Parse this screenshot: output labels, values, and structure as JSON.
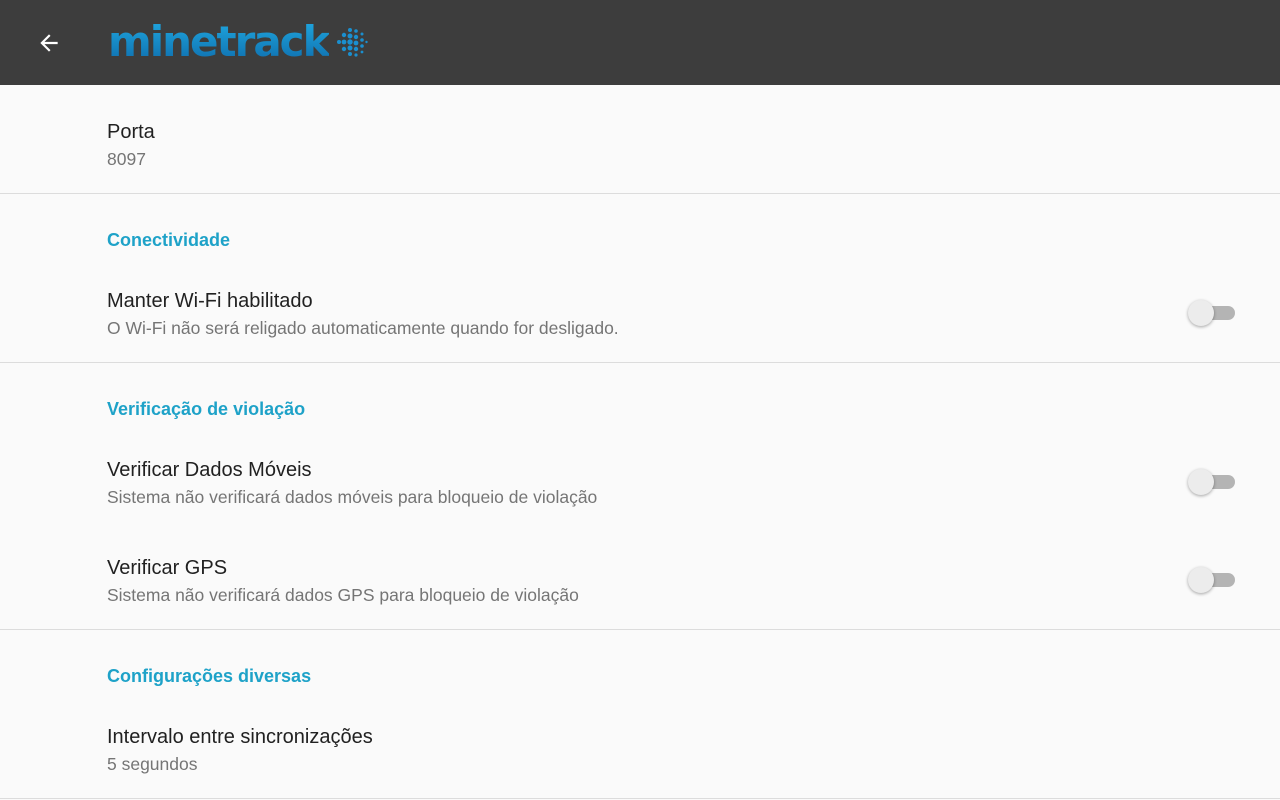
{
  "appbar": {
    "back_icon": "arrow-back-icon",
    "logo_text": "minetrack",
    "logo_mark": "dotted-globe-icon",
    "background": "#3d3d3d",
    "logo_color": "#1485c7"
  },
  "port": {
    "title": "Porta",
    "summary": "8097"
  },
  "connectivity": {
    "header": "Conectividade",
    "keep_wifi": {
      "title": "Manter Wi-Fi habilitado",
      "summary": "O Wi-Fi não será religado automaticamente quando for desligado.",
      "enabled": false
    }
  },
  "violation": {
    "header": "Verificação de violação",
    "mobile_data": {
      "title": "Verificar Dados Móveis",
      "summary": "Sistema não verificará dados móveis para bloqueio de violação",
      "enabled": false
    },
    "gps": {
      "title": "Verificar GPS",
      "summary": "Sistema não verificará dados GPS para bloqueio de violação",
      "enabled": false
    }
  },
  "misc": {
    "header": "Configurações diversas",
    "sync_interval": {
      "title": "Intervalo entre sincronizações",
      "summary": "5 segundos"
    }
  },
  "colors": {
    "category_accent": "#1ea2c8",
    "title_text": "#212121",
    "summary_text": "#757575"
  }
}
